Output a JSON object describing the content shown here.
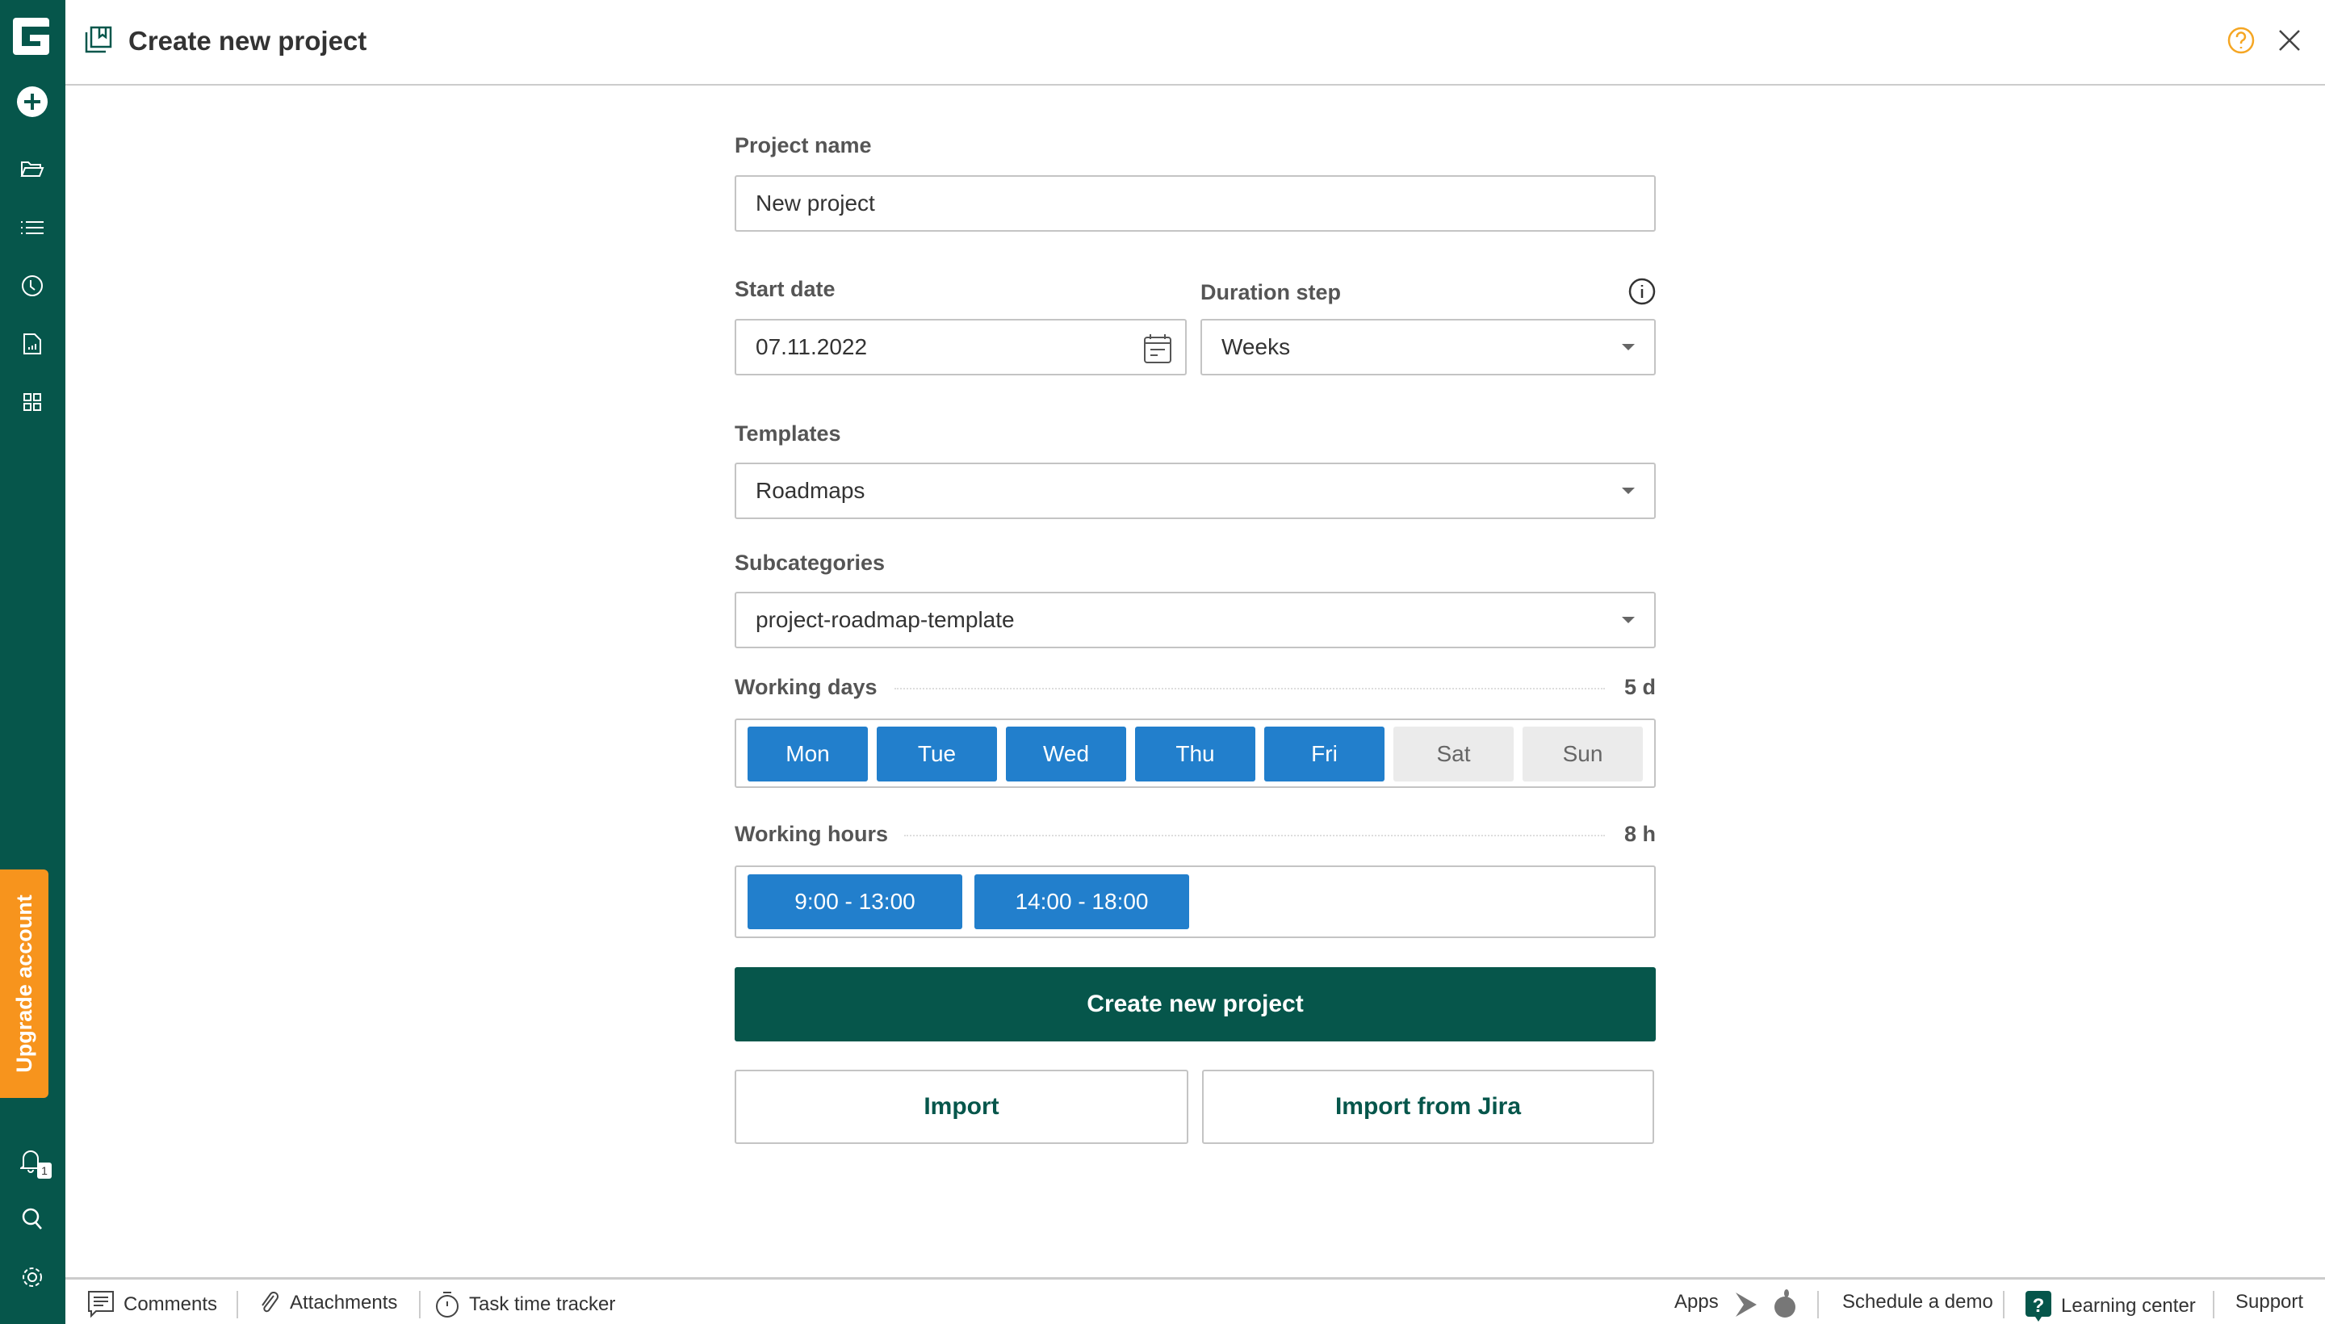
{
  "app": {
    "logo": "G",
    "colors": {
      "brand": "#06564b",
      "accent": "#227fcc",
      "upgrade": "#f7941d"
    }
  },
  "sidebar": {
    "icons": [
      "plus-circle-icon",
      "folder-icon",
      "list-icon",
      "clock-icon",
      "report-icon",
      "grid-icon"
    ],
    "upgrade_label": "Upgrade account",
    "notification_count": "1"
  },
  "header": {
    "title": "Create new project"
  },
  "form": {
    "project_name": {
      "label": "Project name",
      "value": "New project"
    },
    "start_date": {
      "label": "Start date",
      "value": "07.11.2022"
    },
    "duration_step": {
      "label": "Duration step",
      "value": "Weeks"
    },
    "templates": {
      "label": "Templates",
      "value": "Roadmaps"
    },
    "subcategories": {
      "label": "Subcategories",
      "value": "project-roadmap-template"
    },
    "working_days": {
      "label": "Working days",
      "total": "5 d",
      "days": [
        {
          "label": "Mon",
          "active": true
        },
        {
          "label": "Tue",
          "active": true
        },
        {
          "label": "Wed",
          "active": true
        },
        {
          "label": "Thu",
          "active": true
        },
        {
          "label": "Fri",
          "active": true
        },
        {
          "label": "Sat",
          "active": false
        },
        {
          "label": "Sun",
          "active": false
        }
      ]
    },
    "working_hours": {
      "label": "Working hours",
      "total": "8 h",
      "ranges": [
        "9:00 - 13:00",
        "14:00 - 18:00"
      ]
    },
    "create_label": "Create new project",
    "import_label": "Import",
    "import_jira_label": "Import from Jira"
  },
  "footer": {
    "comments": "Comments",
    "attachments": "Attachments",
    "time_tracker": "Task time tracker",
    "apps": "Apps",
    "schedule_demo": "Schedule a demo",
    "learning_center": "Learning center",
    "support": "Support"
  }
}
